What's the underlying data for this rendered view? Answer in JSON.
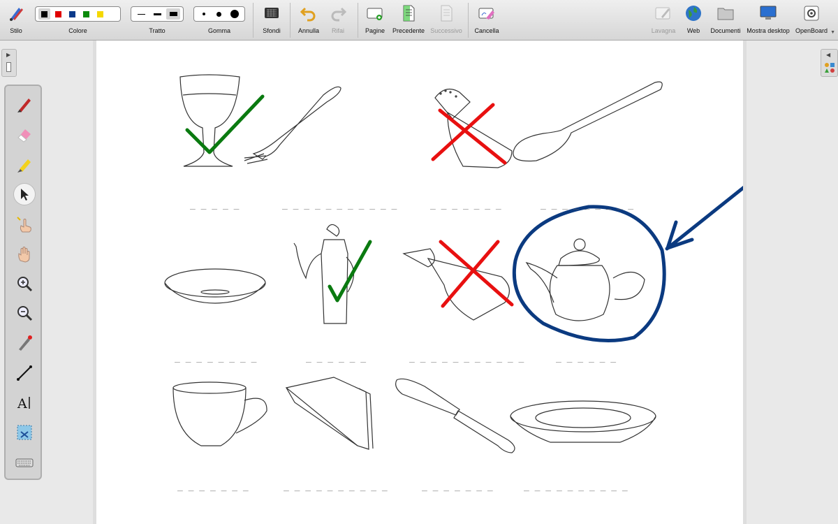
{
  "toolbar": {
    "stylus_label": "Stilo",
    "color_label": "Colore",
    "colors": [
      "#000000",
      "#e00000",
      "#0a3a8a",
      "#0a8a0a",
      "#f5d800"
    ],
    "stroke_label": "Tratto",
    "eraser_label": "Gomma",
    "backgrounds_label": "Sfondi",
    "undo_label": "Annulla",
    "redo_label": "Rifai",
    "pages_label": "Pagine",
    "previous_label": "Precedente",
    "next_label": "Successivo",
    "clear_label": "Cancella",
    "board_label": "Lavagna",
    "web_label": "Web",
    "documents_label": "Documenti",
    "desktop_label": "Mostra desktop",
    "openboard_label": "OpenBoard"
  },
  "tools": [
    "pen",
    "eraser",
    "marker",
    "selector",
    "interactor",
    "hand",
    "zoom-in",
    "zoom-out",
    "laser-pointer",
    "line",
    "text",
    "capture",
    "virtual-keyboard"
  ],
  "worksheet": {
    "blanks": [
      "_ _ _ _ _",
      "_ _ _ _ _ _ _ _ _ _ _",
      "_ _ _ _ _ _ _",
      "_ _ _ _ _ _ _ _ _",
      "_ _ _ _ _ _ _ _",
      "_ _ _ _ _ _",
      "_ _ _ _ _ _ _ _ _ _ _",
      "_ _ _ _ _ _",
      "_ _ _ _ _ _ _",
      "_ _ _ _ _ _ _ _ _ _",
      "_ _ _ _ _ _ _",
      "_ _ _ _ _   _ _ _ _ _"
    ],
    "items": [
      "wine-glass",
      "fork",
      "salt-shaker",
      "spoon",
      "saucer",
      "coffee-pot",
      "sugar-dispenser",
      "teapot",
      "cup",
      "napkin",
      "knife",
      "soup-plate"
    ],
    "annotation_colors": {
      "check": "#0a7a10",
      "cross": "#e81010",
      "circle": "#0b3a80"
    }
  }
}
